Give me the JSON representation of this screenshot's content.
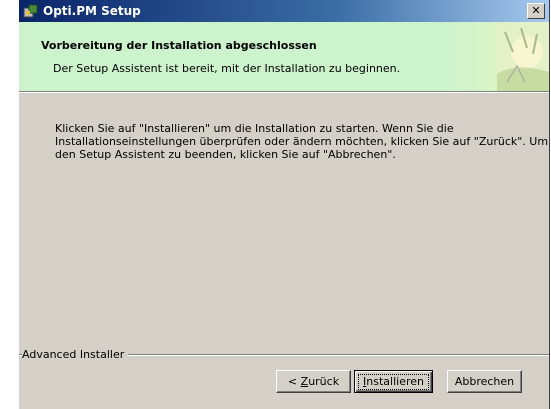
{
  "window": {
    "title": "Opti.PM Setup",
    "close_glyph": "✕"
  },
  "header": {
    "title": "Vorbereitung der Installation abgeschlossen",
    "subtitle": "Der Setup Assistent ist bereit, mit der Installation zu beginnen."
  },
  "body": {
    "lines": [
      "Klicken Sie auf \"Installieren\" um die Installation zu starten. Wenn Sie die",
      "Installationseinstellungen überprüfen oder ändern möchten, klicken Sie auf \"Zurück\". Um",
      "den Setup Assistent zu beenden, klicken Sie auf \"Abbrechen\"."
    ]
  },
  "branding": {
    "label": "Advanced Installer"
  },
  "buttons": {
    "back_prefix": "< ",
    "back_accel": "Z",
    "back_rest": "urück",
    "install_accel": "I",
    "install_rest": "nstallieren",
    "cancel": "Abbrechen"
  },
  "colors": {
    "title_bar": "#0a246a",
    "header_band": "#ccf3cc",
    "dialog_face": "#d4d0c8"
  },
  "icons": {
    "app": "installer-package-icon",
    "header_art": "header-decoration-image"
  }
}
